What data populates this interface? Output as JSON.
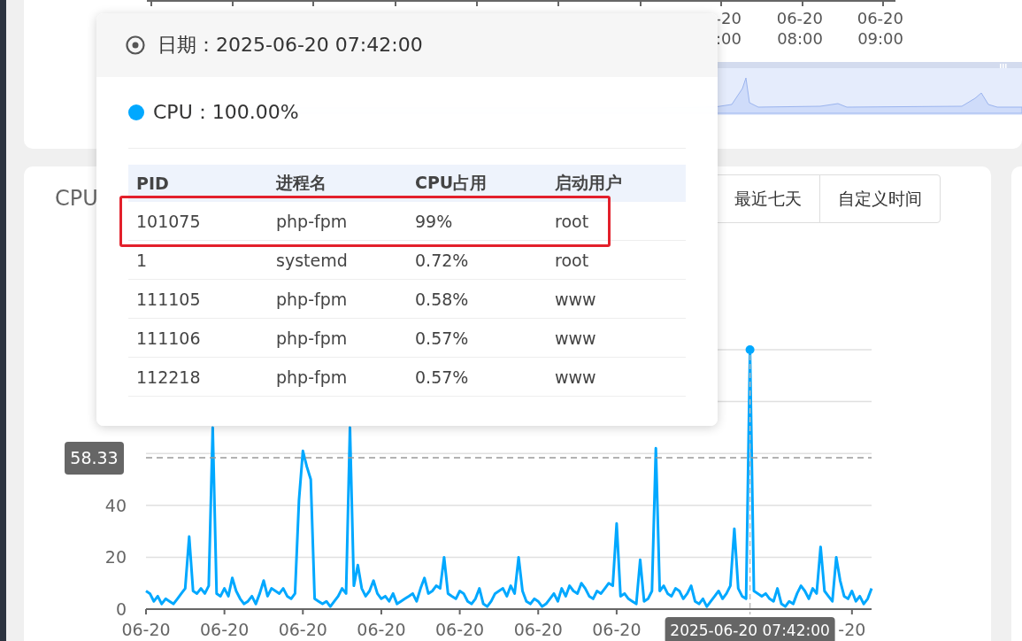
{
  "top_chart": {
    "axis_labels": [
      {
        "date": "-20",
        "time": ":00"
      },
      {
        "date": "06-20",
        "time": "08:00"
      },
      {
        "date": "06-20",
        "time": "09:00"
      }
    ],
    "zoom_slider": {
      "level": 1
    }
  },
  "cpu_panel": {
    "title": "CPU",
    "range_buttons": [
      {
        "label": "最近七天",
        "selected": false
      },
      {
        "label": "自定义时间",
        "selected": false
      }
    ],
    "chart_data": {
      "type": "line",
      "ylim": [
        0,
        100
      ],
      "yticks": [
        0,
        20,
        40
      ],
      "categories": [
        "06-20",
        null,
        null,
        null,
        null,
        null,
        null,
        null,
        null,
        null,
        null,
        null,
        null,
        null,
        null,
        null,
        null,
        null,
        null,
        null,
        "06-20",
        null,
        null,
        null,
        null,
        null,
        null,
        null,
        null,
        null,
        null,
        null,
        null,
        null,
        null,
        null,
        null,
        null,
        null,
        null,
        "06-20",
        null,
        null,
        null,
        null,
        null,
        null,
        null,
        null,
        null,
        null,
        null,
        null,
        null,
        null,
        null,
        null,
        null,
        null,
        null,
        "06-20",
        null,
        null,
        null,
        null,
        null,
        null,
        null,
        null,
        null,
        null,
        null,
        null,
        null,
        null,
        null,
        null,
        null,
        null,
        null,
        "06-20",
        null,
        null,
        null,
        null,
        null,
        null,
        null,
        null,
        null,
        null,
        null,
        null,
        null,
        null,
        null,
        null,
        null,
        null,
        null,
        "06-20",
        null,
        null,
        null,
        null,
        null,
        null,
        null,
        null,
        null,
        null,
        null,
        null,
        null,
        null,
        null,
        null,
        null,
        null,
        null,
        "06-20",
        null,
        null,
        null,
        null,
        null,
        null,
        null,
        null,
        null,
        null,
        null,
        null,
        null,
        null,
        null,
        null,
        null,
        null,
        null,
        null,
        null,
        null,
        null,
        null,
        null,
        null,
        null,
        null,
        null,
        null,
        null,
        null,
        null,
        null,
        null,
        null,
        null,
        null,
        null,
        null,
        null,
        null,
        null,
        null,
        null,
        null,
        null,
        null,
        null,
        null,
        null,
        null,
        null,
        null,
        null,
        null,
        null,
        null,
        null,
        "-20",
        null,
        null,
        null,
        null,
        null
      ],
      "series": [
        {
          "color": "#00a8ff",
          "values": [
            7,
            6,
            3,
            5,
            2,
            4,
            3,
            2,
            4,
            6,
            8,
            28,
            7,
            6,
            8,
            6,
            9,
            70,
            6,
            5,
            8,
            5,
            12,
            7,
            4,
            2,
            3,
            5,
            2,
            6,
            11,
            5,
            8,
            7,
            6,
            8,
            5,
            4,
            6,
            42,
            61,
            55,
            50,
            4,
            3,
            2,
            3,
            1,
            3,
            5,
            8,
            6,
            70,
            9,
            17,
            8,
            5,
            7,
            11,
            6,
            4,
            5,
            3,
            6,
            2,
            3,
            4,
            5,
            6,
            3,
            8,
            12,
            6,
            7,
            9,
            8,
            20,
            6,
            5,
            4,
            7,
            6,
            3,
            2,
            4,
            8,
            2,
            1,
            3,
            6,
            7,
            8,
            5,
            9,
            6,
            20,
            7,
            3,
            2,
            4,
            3,
            1,
            2,
            4,
            6,
            3,
            8,
            5,
            9,
            7,
            6,
            10,
            8,
            5,
            4,
            7,
            6,
            8,
            10,
            9,
            33,
            5,
            6,
            4,
            3,
            2,
            19,
            3,
            4,
            7,
            62,
            7,
            9,
            6,
            5,
            8,
            7,
            4,
            6,
            9,
            3,
            2,
            4,
            1,
            3,
            5,
            7,
            4,
            6,
            9,
            31,
            8,
            5,
            4,
            100,
            7,
            6,
            5,
            6,
            4,
            3,
            8,
            2,
            1,
            3,
            2,
            6,
            9,
            7,
            4,
            8,
            6,
            24,
            7,
            5,
            3,
            20,
            11,
            5,
            4,
            7,
            3,
            5,
            2,
            4,
            8
          ]
        }
      ],
      "ref_lines": [
        {
          "axis": "y",
          "value": 58.33,
          "label": "58.33"
        }
      ],
      "annotations": [
        "2025-06-20 07:42:00"
      ]
    }
  },
  "tooltip": {
    "date_label": "日期：2025-06-20 07:42:00",
    "series_label": "CPU：100.00%",
    "columns": [
      "PID",
      "进程名",
      "CPU占用",
      "启动用户"
    ],
    "rows": [
      {
        "cells": [
          "101075",
          "php-fpm",
          "99%",
          "root"
        ],
        "highlighted": true
      },
      {
        "cells": [
          "1",
          "systemd",
          "0.72%",
          "root"
        ],
        "highlighted": false
      },
      {
        "cells": [
          "111105",
          "php-fpm",
          "0.58%",
          "www"
        ],
        "highlighted": false
      },
      {
        "cells": [
          "111106",
          "php-fpm",
          "0.57%",
          "www"
        ],
        "highlighted": false
      },
      {
        "cells": [
          "112218",
          "php-fpm",
          "0.57%",
          "www"
        ],
        "highlighted": false
      }
    ]
  }
}
